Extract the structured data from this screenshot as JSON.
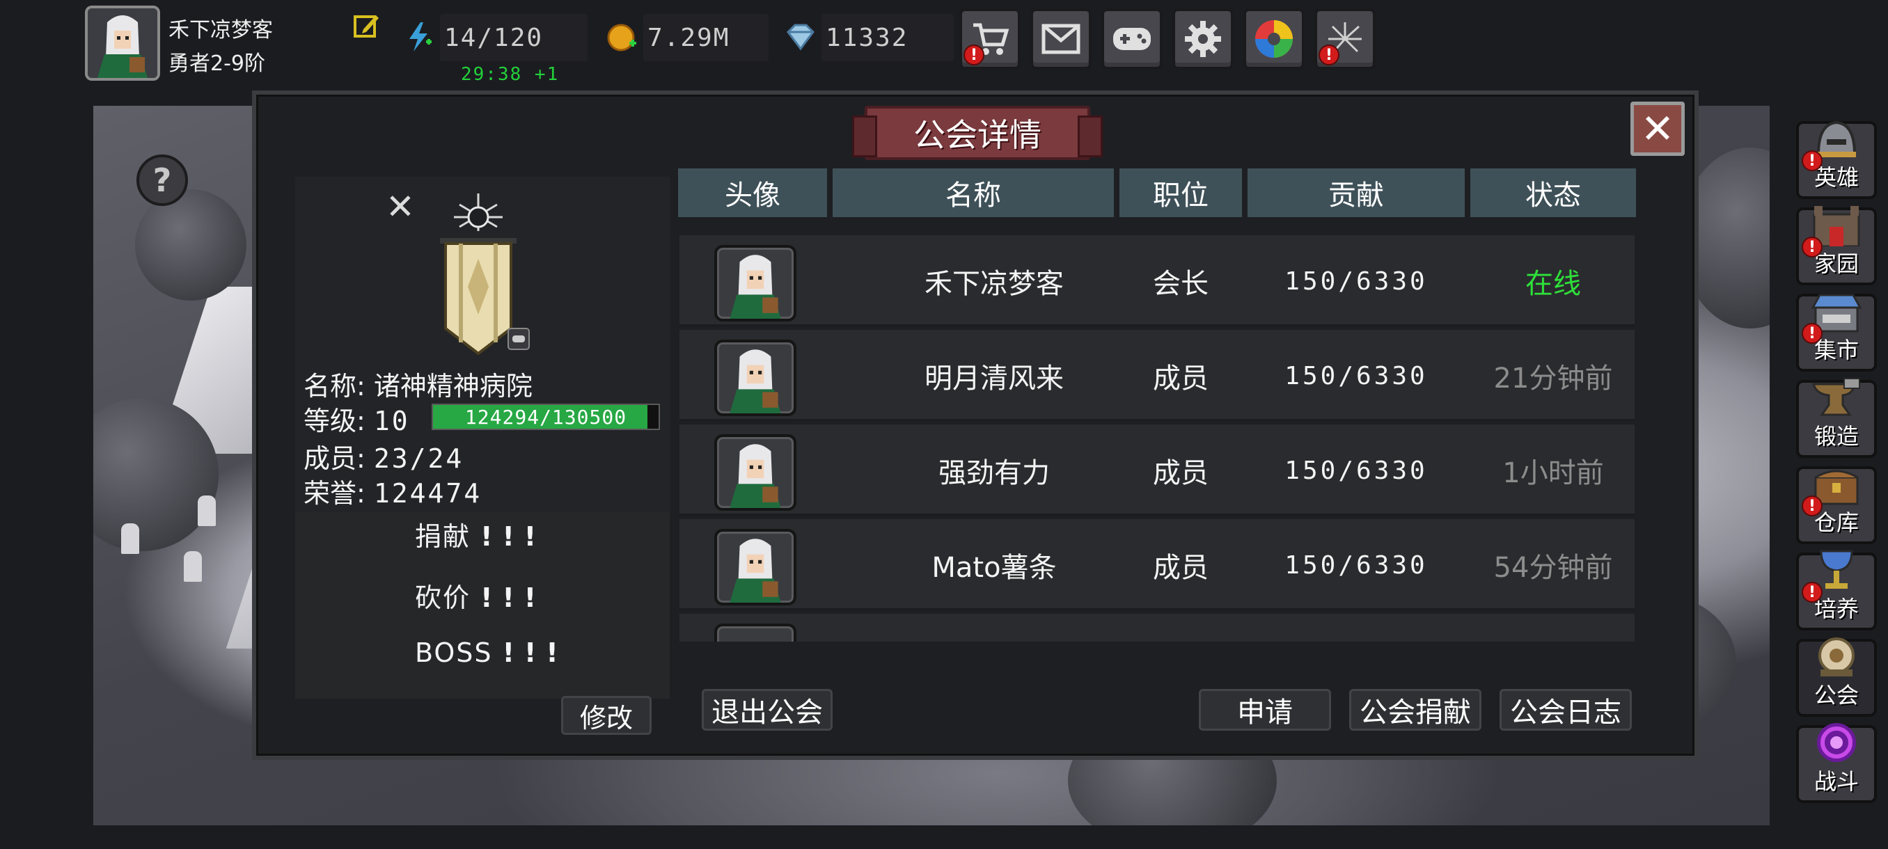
{
  "player": {
    "name": "禾下凉梦客",
    "rank": "勇者2-9阶"
  },
  "resources": {
    "energy": "14/120",
    "energy_timer": "29:38 +1",
    "gold": "7.29M",
    "gems": "11332"
  },
  "top_buttons": [
    {
      "icon": "cart-icon",
      "alert": true
    },
    {
      "icon": "mail-icon",
      "alert": false
    },
    {
      "icon": "gamepad-icon",
      "alert": false
    },
    {
      "icon": "gear-icon",
      "alert": false
    },
    {
      "icon": "color-wheel-icon",
      "alert": false
    },
    {
      "icon": "fireworks-icon",
      "alert": true
    }
  ],
  "sidebar": [
    {
      "label": "英雄",
      "icon": "helmet-icon",
      "alert": true
    },
    {
      "label": "家园",
      "icon": "castle-icon",
      "alert": true
    },
    {
      "label": "集市",
      "icon": "shop-icon",
      "alert": true
    },
    {
      "label": "锻造",
      "icon": "anvil-icon",
      "alert": false
    },
    {
      "label": "仓库",
      "icon": "chest-icon",
      "alert": true
    },
    {
      "label": "培养",
      "icon": "goblet-icon",
      "alert": true
    },
    {
      "label": "公会",
      "icon": "guild-icon",
      "alert": false
    },
    {
      "label": "战斗",
      "icon": "portal-icon",
      "alert": false
    }
  ],
  "modal": {
    "title": "公会详情",
    "guild": {
      "name_label": "名称:",
      "name": "诸神精神病院",
      "level_label": "等级:",
      "level": "10",
      "xp_text": "124294/130500",
      "xp_fraction": 0.952,
      "members_label": "成员:",
      "members": "23/24",
      "honor_label": "荣誉:",
      "honor": "124474"
    },
    "notices": [
      {
        "label": "捐献",
        "marks": "!!!"
      },
      {
        "label": "砍价",
        "marks": "!!!"
      },
      {
        "label": "BOSS",
        "marks": "!!!"
      }
    ],
    "edit_button": "修改",
    "leave_button": "退出公会",
    "apply_button": "申请",
    "donate_button": "公会捐献",
    "log_button": "公会日志",
    "columns": [
      "头像",
      "名称",
      "职位",
      "贡献",
      "状态"
    ],
    "members": [
      {
        "name": "禾下凉梦客",
        "role": "会长",
        "contribution": "150/6330",
        "status": "在线",
        "online": true
      },
      {
        "name": "明月清风来",
        "role": "成员",
        "contribution": "150/6330",
        "status": "21分钟前",
        "online": false
      },
      {
        "name": "强劲有力",
        "role": "成员",
        "contribution": "150/6330",
        "status": "1小时前",
        "online": false
      },
      {
        "name": "Mato薯条",
        "role": "成员",
        "contribution": "150/6330",
        "status": "54分钟前",
        "online": false
      }
    ]
  },
  "colors": {
    "online": "#2ee03a",
    "offline": "#8c8c8c",
    "xp": "#27a844",
    "header": "#3f5158"
  }
}
